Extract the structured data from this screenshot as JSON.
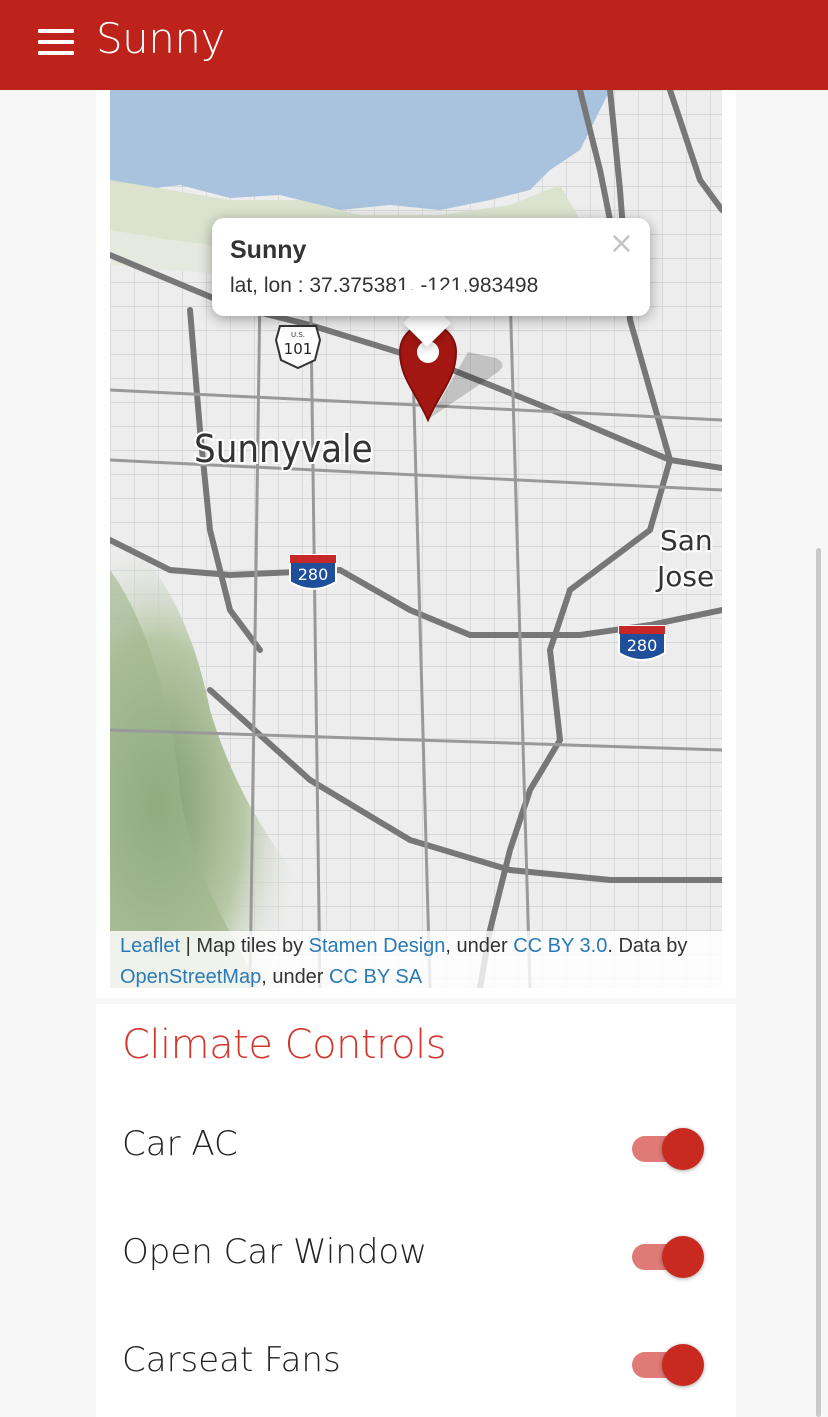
{
  "app": {
    "title": "Sunny"
  },
  "map": {
    "popup": {
      "title": "Sunny",
      "coords": "lat, lon : 37.375381, -121.983498",
      "close_glyph": "×"
    },
    "labels": {
      "sunnyvale": "Sunnyvale",
      "san": "San",
      "jose": "Jose"
    },
    "shields": {
      "us101_top": "U.S.",
      "us101": "101",
      "i280_a": "280",
      "i280_b": "280"
    },
    "attribution": {
      "leaflet": "Leaflet",
      "sep1": " | Map tiles by ",
      "stamen": "Stamen Design",
      "sep2": ", under ",
      "ccby": "CC BY 3.0",
      "sep3": ". Data by ",
      "osm": "OpenStreetMap",
      "sep4": ", under ",
      "ccbysa": "CC BY SA"
    },
    "marker_color": "#a21712"
  },
  "climate": {
    "title": "Climate Controls",
    "items": [
      {
        "label": "Car AC",
        "on": true
      },
      {
        "label": "Open Car Window",
        "on": true
      },
      {
        "label": "Carseat Fans",
        "on": true
      }
    ]
  },
  "colors": {
    "primary": "#bd231b",
    "accent": "#d2372c",
    "toggle_track": "#e07a76",
    "link": "#2a7ab8"
  }
}
